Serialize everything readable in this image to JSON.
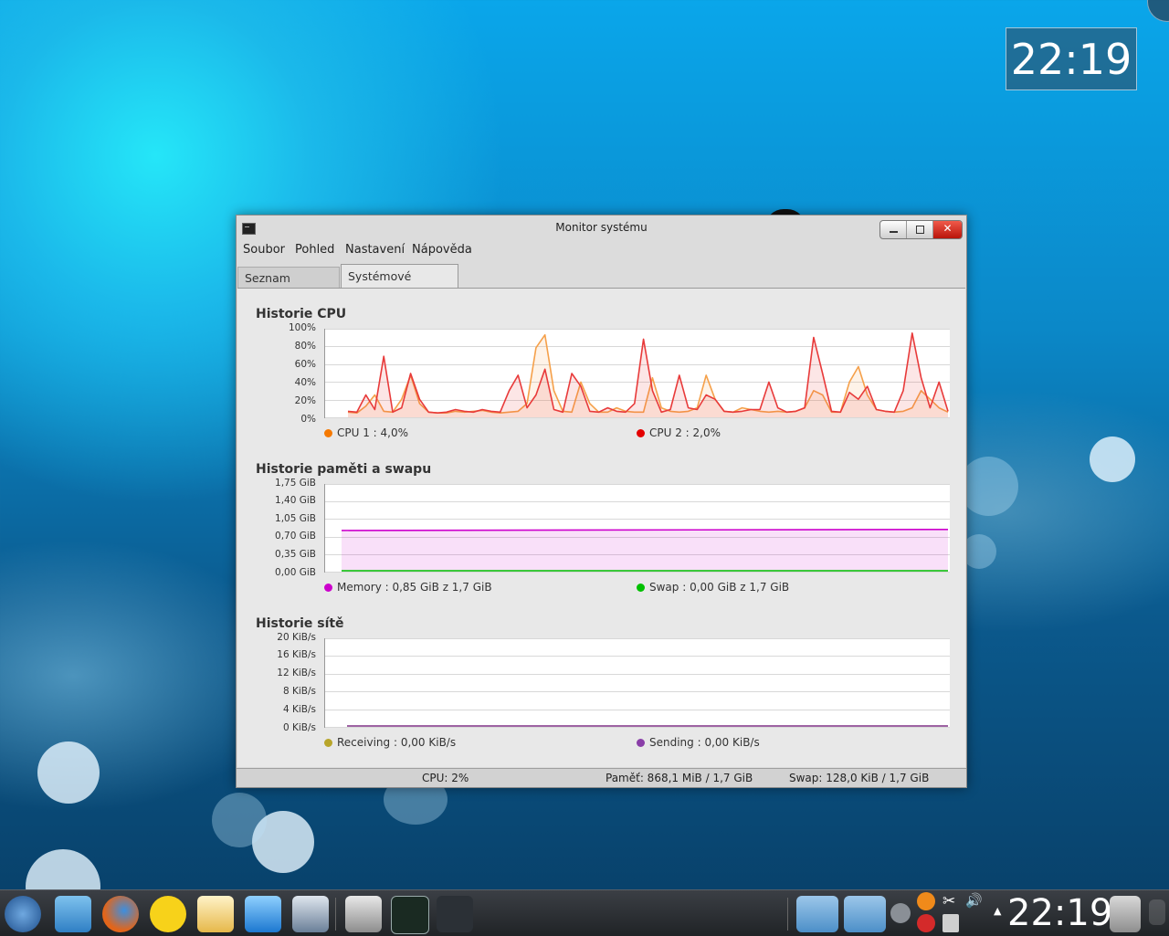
{
  "desktop": {
    "clock_time": "22:19"
  },
  "window": {
    "title": "Monitor systému",
    "menu": [
      "Soubor",
      "Pohled",
      "Nastavení",
      "Nápověda"
    ],
    "tabs": [
      "Seznam procesů",
      "Systémové zatížení"
    ],
    "active_tab": "Systémové zatížení"
  },
  "cpu_history": {
    "title": "Historie CPU",
    "y_ticks": [
      "100%",
      "80%",
      "60%",
      "40%",
      "20%",
      "0%"
    ],
    "legend": [
      {
        "label": "CPU 1 : 4,0%",
        "color": "#f57900"
      },
      {
        "label": "CPU 2 : 2,0%",
        "color": "#e40000"
      }
    ]
  },
  "memory_history": {
    "title": "Historie paměti a swapu",
    "y_ticks": [
      "1,75 GiB",
      "1,40 GiB",
      "1,05 GiB",
      "0,70 GiB",
      "0,35 GiB",
      "0,00 GiB"
    ],
    "legend": [
      {
        "label": "Memory : 0,85 GiB z 1,7 GiB",
        "color": "#cc00cc"
      },
      {
        "label": "Swap : 0,00 GiB z 1,7 GiB",
        "color": "#00c000"
      }
    ]
  },
  "network_history": {
    "title": "Historie sítě",
    "y_ticks": [
      "20 KiB/s",
      "16 KiB/s",
      "12 KiB/s",
      "8 KiB/s",
      "4 KiB/s",
      "0 KiB/s"
    ],
    "legend": [
      {
        "label": "Receiving : 0,00 KiB/s",
        "color": "#b8a52a"
      },
      {
        "label": "Sending : 0,00 KiB/s",
        "color": "#8a3ea8"
      }
    ]
  },
  "statusbar": {
    "cpu": "CPU: 2%",
    "memory": "Paměť: 868,1 MiB / 1,7 GiB",
    "swap": "Swap: 128,0 KiB / 1,7 GiB"
  },
  "taskbar": {
    "clock_time": "22:19",
    "launchers": [
      "kickoff-icon",
      "file-manager-icon",
      "firefox-icon",
      "chat-icon",
      "mail-icon",
      "media-player-icon",
      "settings-icon",
      "camera-icon",
      "system-monitor-icon",
      "usb-drive-icon"
    ],
    "tray": [
      "folder-icon",
      "download-folder-icon",
      "info-icon",
      "help-icon",
      "scissors-icon",
      "volume-icon",
      "update-icon",
      "battery-icon",
      "trash-icon"
    ]
  },
  "chart_data": [
    {
      "type": "line",
      "title": "Historie CPU",
      "ylim": [
        0,
        100
      ],
      "y_unit": "%",
      "x_points": 68,
      "series": [
        {
          "name": "CPU 1",
          "values": [
            5,
            4,
            12,
            25,
            6,
            5,
            20,
            48,
            15,
            5,
            4,
            4,
            6,
            5,
            6,
            7,
            5,
            4,
            5,
            6,
            15,
            80,
            95,
            30,
            6,
            5,
            40,
            15,
            5,
            5,
            10,
            6,
            5,
            5,
            45,
            10,
            6,
            5,
            6,
            10,
            48,
            20,
            6,
            5,
            10,
            8,
            6,
            5,
            6,
            5,
            6,
            10,
            30,
            25,
            5,
            5,
            40,
            58,
            25,
            8,
            6,
            5,
            6,
            10,
            30,
            20,
            10,
            5
          ],
          "color": "#f5a04a"
        },
        {
          "name": "CPU 2",
          "values": [
            6,
            5,
            25,
            8,
            70,
            5,
            10,
            50,
            20,
            5,
            4,
            5,
            8,
            6,
            5,
            8,
            6,
            5,
            30,
            48,
            10,
            25,
            55,
            8,
            5,
            50,
            35,
            6,
            5,
            10,
            6,
            5,
            15,
            90,
            30,
            5,
            8,
            48,
            10,
            8,
            25,
            20,
            6,
            5,
            6,
            8,
            8,
            40,
            10,
            5,
            6,
            10,
            92,
            50,
            6,
            5,
            28,
            20,
            35,
            8,
            6,
            5,
            30,
            97,
            45,
            10,
            40,
            6
          ],
          "color": "#e83a3a"
        }
      ]
    },
    {
      "type": "area",
      "title": "Historie paměti a swapu",
      "ylim": [
        0,
        1.75
      ],
      "y_unit": "GiB",
      "x_points": 2,
      "series": [
        {
          "name": "Memory",
          "values": [
            0.83,
            0.85
          ],
          "color": "#cc00cc"
        },
        {
          "name": "Swap",
          "values": [
            0.0,
            0.0
          ],
          "color": "#00c000"
        }
      ]
    },
    {
      "type": "line",
      "title": "Historie sítě",
      "ylim": [
        0,
        20
      ],
      "y_unit": "KiB/s",
      "x_points": 2,
      "series": [
        {
          "name": "Receiving",
          "values": [
            0,
            0
          ],
          "color": "#b8a52a"
        },
        {
          "name": "Sending",
          "values": [
            0,
            0
          ],
          "color": "#8a3ea8"
        }
      ]
    }
  ]
}
